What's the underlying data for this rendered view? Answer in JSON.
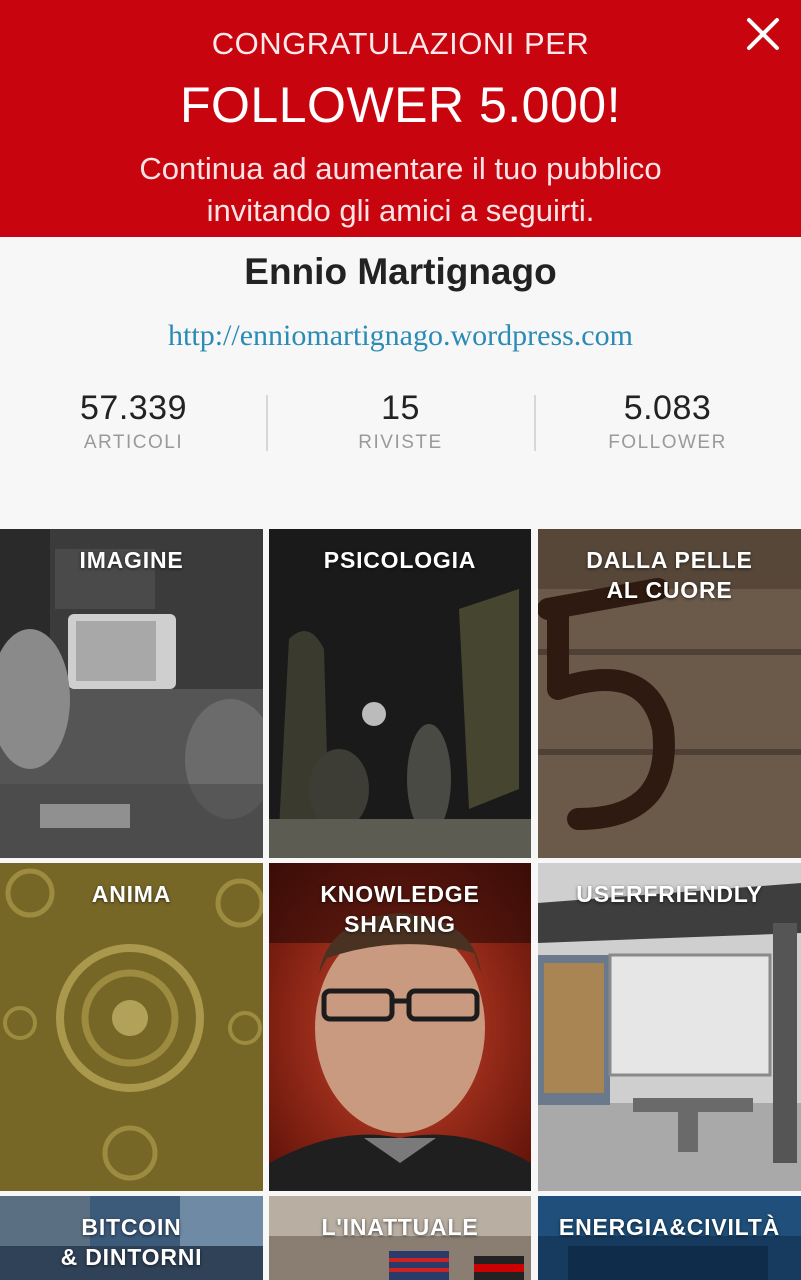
{
  "banner": {
    "line1": "CONGRATULAZIONI PER",
    "line2": "FOLLOWER 5.000!",
    "message_line1": "Continua ad aumentare il tuo pubblico",
    "message_line2": "invitando gli amici a seguirti.",
    "color": "#c8050f",
    "close_icon": "close-icon"
  },
  "profile": {
    "name": "Ennio Martignago",
    "url": "http://enniomartignago.wordpress.com",
    "stats": [
      {
        "value": "57.339",
        "label": "ARTICOLI"
      },
      {
        "value": "15",
        "label": "RIVISTE"
      },
      {
        "value": "5.083",
        "label": "FOLLOWER"
      }
    ]
  },
  "magazines": [
    {
      "title_line1": "IMAGINE",
      "title_line2": ""
    },
    {
      "title_line1": "PSICOLOGIA",
      "title_line2": ""
    },
    {
      "title_line1": "DALLA PELLE",
      "title_line2": "AL CUORE"
    },
    {
      "title_line1": "ANIMA",
      "title_line2": ""
    },
    {
      "title_line1": "KNOWLEDGE",
      "title_line2": "SHARING"
    },
    {
      "title_line1": "USERFRIENDLY",
      "title_line2": ""
    },
    {
      "title_line1": "BITCOIN",
      "title_line2": "& DINTORNI"
    },
    {
      "title_line1": "L'INATTUALE",
      "title_line2": ""
    },
    {
      "title_line1": "ENERGIA&CIVILTÀ",
      "title_line2": ""
    }
  ]
}
